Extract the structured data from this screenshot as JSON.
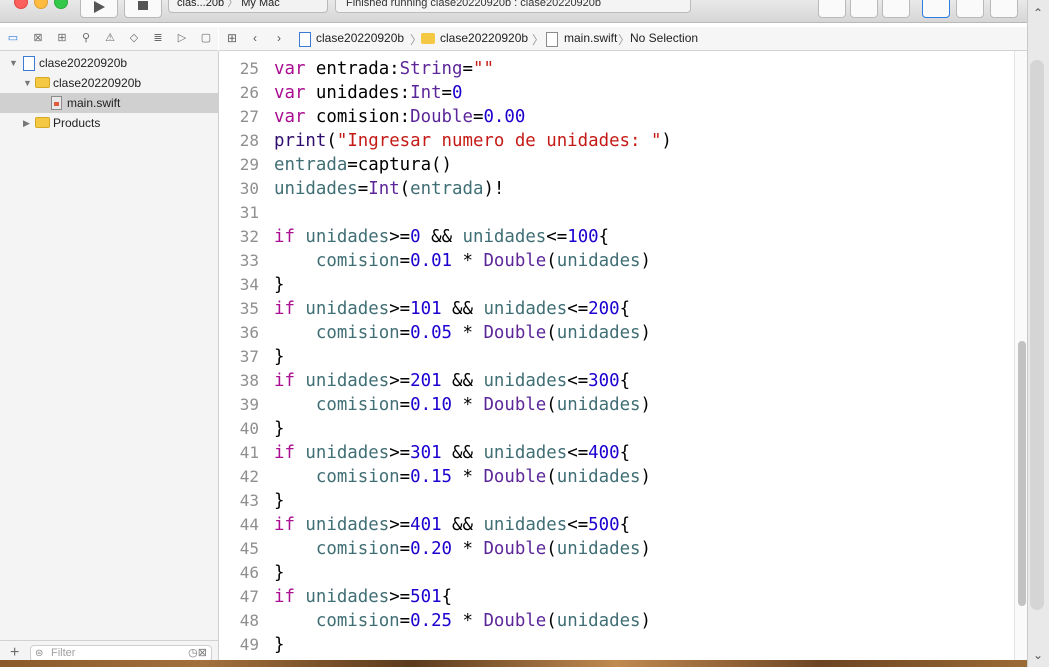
{
  "toolbar": {
    "scheme_label": "clas...20b",
    "destination_label": "My Mac",
    "activity_text": "Finished running clase20220920b : clase20220920b"
  },
  "navigator_icons": [
    "folder-icon",
    "source-control-icon",
    "symbol-icon",
    "search-icon",
    "issue-icon",
    "test-icon",
    "debug-icon",
    "breakpoint-icon",
    "report-icon"
  ],
  "jumpbar": {
    "items": [
      "clase20220920b",
      "clase20220920b",
      "main.swift",
      "No Selection"
    ]
  },
  "sidebar": {
    "items": [
      {
        "label": "clase20220920b",
        "kind": "project"
      },
      {
        "label": "clase20220920b",
        "kind": "folder"
      },
      {
        "label": "main.swift",
        "kind": "file"
      },
      {
        "label": "Products",
        "kind": "folder"
      }
    ],
    "filter_placeholder": "Filter"
  },
  "editor": {
    "lines": [
      {
        "n": "25",
        "tokens": [
          [
            "kw",
            "var"
          ],
          [
            "",
            "entrada:"
          ],
          [
            "ty",
            "String"
          ],
          [
            "",
            "="
          ],
          [
            "str",
            "\"\""
          ]
        ]
      },
      {
        "n": "26",
        "tokens": [
          [
            "kw",
            "var"
          ],
          [
            "",
            "unidades:"
          ],
          [
            "ty",
            "Int"
          ],
          [
            "",
            "="
          ],
          [
            "num",
            "0"
          ]
        ]
      },
      {
        "n": "27",
        "tokens": [
          [
            "kw",
            "var"
          ],
          [
            "",
            "comision:"
          ],
          [
            "ty",
            "Double"
          ],
          [
            "",
            "="
          ],
          [
            "num",
            "0.00"
          ]
        ]
      },
      {
        "n": "28",
        "tokens": [
          [
            "fn",
            "print"
          ],
          [
            "",
            "("
          ],
          [
            "str",
            "\"Ingresar numero de unidades: \""
          ],
          [
            "",
            ")"
          ]
        ]
      },
      {
        "n": "29",
        "tokens": [
          [
            "id",
            "entrada"
          ],
          [
            "",
            "=captura()"
          ]
        ]
      },
      {
        "n": "30",
        "tokens": [
          [
            "id",
            "unidades"
          ],
          [
            "",
            "="
          ],
          [
            "ty",
            "Int"
          ],
          [
            "",
            "("
          ],
          [
            "id",
            "entrada"
          ],
          [
            "",
            ")!"
          ]
        ]
      },
      {
        "n": "31",
        "tokens": []
      },
      {
        "n": "32",
        "tokens": [
          [
            "kw",
            "if"
          ],
          [
            "id",
            "unidades"
          ],
          [
            "",
            ">="
          ],
          [
            "num",
            "0"
          ],
          [
            "",
            " && "
          ],
          [
            "id",
            "unidades"
          ],
          [
            "",
            "<="
          ],
          [
            "num",
            "100"
          ],
          [
            "",
            "{"
          ]
        ]
      },
      {
        "n": "33",
        "tokens": [
          [
            "",
            "    "
          ],
          [
            "id",
            "comision"
          ],
          [
            "",
            "="
          ],
          [
            "num",
            "0.01"
          ],
          [
            "",
            " * "
          ],
          [
            "ty",
            "Double"
          ],
          [
            "",
            "("
          ],
          [
            "id",
            "unidades"
          ],
          [
            "",
            ")"
          ]
        ]
      },
      {
        "n": "34",
        "tokens": [
          [
            "",
            "}"
          ]
        ]
      },
      {
        "n": "35",
        "tokens": [
          [
            "kw",
            "if"
          ],
          [
            "id",
            "unidades"
          ],
          [
            "",
            ">="
          ],
          [
            "num",
            "101"
          ],
          [
            "",
            " && "
          ],
          [
            "id",
            "unidades"
          ],
          [
            "",
            "<="
          ],
          [
            "num",
            "200"
          ],
          [
            "",
            "{"
          ]
        ]
      },
      {
        "n": "36",
        "tokens": [
          [
            "",
            "    "
          ],
          [
            "id",
            "comision"
          ],
          [
            "",
            "="
          ],
          [
            "num",
            "0.05"
          ],
          [
            "",
            " * "
          ],
          [
            "ty",
            "Double"
          ],
          [
            "",
            "("
          ],
          [
            "id",
            "unidades"
          ],
          [
            "",
            ")"
          ]
        ]
      },
      {
        "n": "37",
        "tokens": [
          [
            "",
            "}"
          ]
        ]
      },
      {
        "n": "38",
        "tokens": [
          [
            "kw",
            "if"
          ],
          [
            "id",
            "unidades"
          ],
          [
            "",
            ">="
          ],
          [
            "num",
            "201"
          ],
          [
            "",
            " && "
          ],
          [
            "id",
            "unidades"
          ],
          [
            "",
            "<="
          ],
          [
            "num",
            "300"
          ],
          [
            "",
            "{"
          ]
        ]
      },
      {
        "n": "39",
        "tokens": [
          [
            "",
            "    "
          ],
          [
            "id",
            "comision"
          ],
          [
            "",
            "="
          ],
          [
            "num",
            "0.10"
          ],
          [
            "",
            " * "
          ],
          [
            "ty",
            "Double"
          ],
          [
            "",
            "("
          ],
          [
            "id",
            "unidades"
          ],
          [
            "",
            ")"
          ]
        ]
      },
      {
        "n": "40",
        "tokens": [
          [
            "",
            "}"
          ]
        ]
      },
      {
        "n": "41",
        "tokens": [
          [
            "kw",
            "if"
          ],
          [
            "id",
            "unidades"
          ],
          [
            "",
            ">="
          ],
          [
            "num",
            "301"
          ],
          [
            "",
            " && "
          ],
          [
            "id",
            "unidades"
          ],
          [
            "",
            "<="
          ],
          [
            "num",
            "400"
          ],
          [
            "",
            "{"
          ]
        ]
      },
      {
        "n": "42",
        "tokens": [
          [
            "",
            "    "
          ],
          [
            "id",
            "comision"
          ],
          [
            "",
            "="
          ],
          [
            "num",
            "0.15"
          ],
          [
            "",
            " * "
          ],
          [
            "ty",
            "Double"
          ],
          [
            "",
            "("
          ],
          [
            "id",
            "unidades"
          ],
          [
            "",
            ")"
          ]
        ]
      },
      {
        "n": "43",
        "tokens": [
          [
            "",
            "}"
          ]
        ]
      },
      {
        "n": "44",
        "tokens": [
          [
            "kw",
            "if"
          ],
          [
            "id",
            "unidades"
          ],
          [
            "",
            ">="
          ],
          [
            "num",
            "401"
          ],
          [
            "",
            " && "
          ],
          [
            "id",
            "unidades"
          ],
          [
            "",
            "<="
          ],
          [
            "num",
            "500"
          ],
          [
            "",
            "{"
          ]
        ]
      },
      {
        "n": "45",
        "tokens": [
          [
            "",
            "    "
          ],
          [
            "id",
            "comision"
          ],
          [
            "",
            "="
          ],
          [
            "num",
            "0.20"
          ],
          [
            "",
            " * "
          ],
          [
            "ty",
            "Double"
          ],
          [
            "",
            "("
          ],
          [
            "id",
            "unidades"
          ],
          [
            "",
            ")"
          ]
        ]
      },
      {
        "n": "46",
        "tokens": [
          [
            "",
            "}"
          ]
        ]
      },
      {
        "n": "47",
        "tokens": [
          [
            "kw",
            "if"
          ],
          [
            "id",
            "unidades"
          ],
          [
            "",
            ">="
          ],
          [
            "num",
            "501"
          ],
          [
            "",
            "{"
          ]
        ]
      },
      {
        "n": "48",
        "tokens": [
          [
            "",
            "    "
          ],
          [
            "id",
            "comision"
          ],
          [
            "",
            "="
          ],
          [
            "num",
            "0.25"
          ],
          [
            "",
            " * "
          ],
          [
            "ty",
            "Double"
          ],
          [
            "",
            "("
          ],
          [
            "id",
            "unidades"
          ],
          [
            "",
            ")"
          ]
        ]
      },
      {
        "n": "49",
        "tokens": [
          [
            "",
            "}"
          ]
        ]
      }
    ]
  },
  "colors": {
    "keyword": "#aa0d91",
    "type": "#5c2699",
    "number": "#1c00cf",
    "string": "#c41a16",
    "identifier": "#3f6e74",
    "selection": "#d0d0d0"
  }
}
